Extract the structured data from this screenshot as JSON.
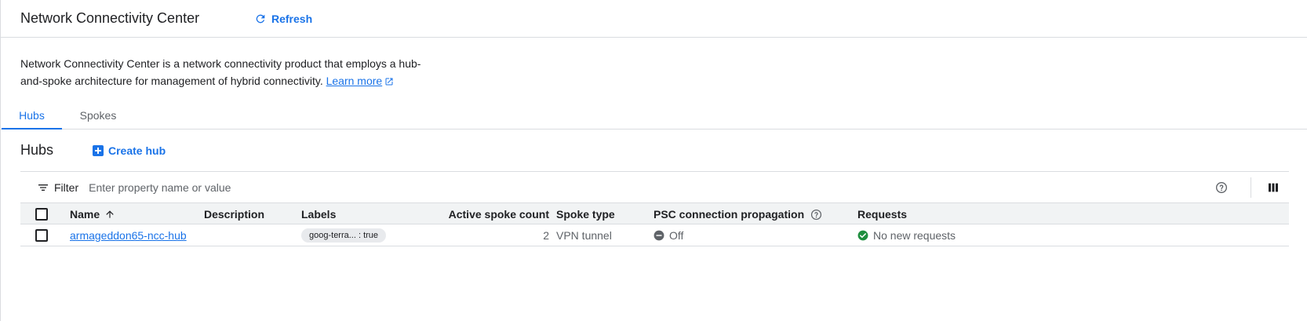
{
  "header": {
    "title": "Network Connectivity Center",
    "refresh_label": "Refresh"
  },
  "intro": {
    "text": "Network Connectivity Center is a network connectivity product that employs a hub-and-spoke architecture for management of hybrid connectivity.",
    "learn_more": "Learn more"
  },
  "tabs": [
    {
      "label": "Hubs",
      "active": true
    },
    {
      "label": "Spokes",
      "active": false
    }
  ],
  "section": {
    "title": "Hubs",
    "create_label": "Create hub"
  },
  "filter": {
    "label": "Filter",
    "placeholder": "Enter property name or value"
  },
  "table": {
    "columns": {
      "name": "Name",
      "description": "Description",
      "labels": "Labels",
      "active_spoke_count": "Active spoke count",
      "spoke_type": "Spoke type",
      "psc": "PSC connection propagation",
      "requests": "Requests"
    },
    "rows": [
      {
        "name": "armageddon65-ncc-hub",
        "description": "",
        "label_chip": "goog-terra... : true",
        "active_spoke_count": "2",
        "spoke_type": "VPN tunnel",
        "psc": "Off",
        "requests": "No new requests"
      }
    ]
  },
  "colors": {
    "accent": "#1a73e8",
    "success": "#1e8e3e",
    "off": "#5f6368"
  }
}
